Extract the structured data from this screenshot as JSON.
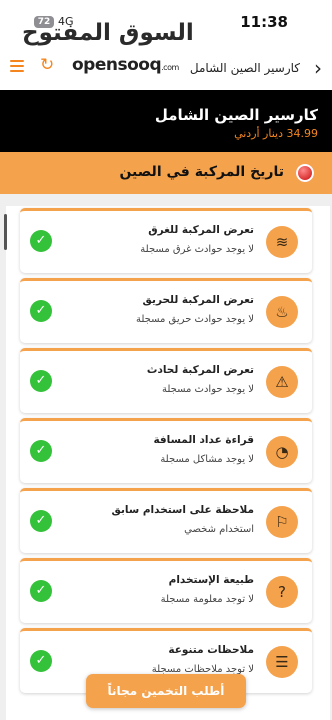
{
  "status_bar": {
    "battery": "72",
    "network": "4G",
    "time": "11:38"
  },
  "brand_arabic": "السوق المفتوح",
  "header": {
    "logo_text": "opensooq",
    "logo_suffix": ".com",
    "title": "كارسير الصين الشامل",
    "menu_icon": "hamburger-icon",
    "refresh_icon": "refresh-icon",
    "back_icon": "chevron-right-icon"
  },
  "car": {
    "name": "كارسير الصين الشامل",
    "price": "34.99 دينار أردني"
  },
  "section": {
    "title": "تاريخ المركبة في الصين"
  },
  "items": [
    {
      "title": "تعرض المركبة للغرق",
      "subtitle": "لا يوجد حوادث غرق مسجلة",
      "icon": "flood-car-icon",
      "glyph": "≋"
    },
    {
      "title": "تعرض المركبة للحريق",
      "subtitle": "لا يوجد حوادث حريق مسجلة",
      "icon": "fire-car-icon",
      "glyph": "♨"
    },
    {
      "title": "تعرض المركبة لحادث",
      "subtitle": "لا يوجد حوادث مسجلة",
      "icon": "crash-car-icon",
      "glyph": "⚠"
    },
    {
      "title": "قراءة عداد المسافة",
      "subtitle": "لا يوجد مشاكل مسجلة",
      "icon": "odometer-car-icon",
      "glyph": "◔"
    },
    {
      "title": "ملاحظة على استخدام سابق",
      "subtitle": "استخدام شخصي",
      "icon": "previous-use-car-icon",
      "glyph": "⚐"
    },
    {
      "title": "طبيعة الإستخدام",
      "subtitle": "لا توجد معلومة مسجلة",
      "icon": "usage-car-icon",
      "glyph": "?"
    },
    {
      "title": "ملاحظات متنوعة",
      "subtitle": "لا توجد ملاحظات مسجلة",
      "icon": "notes-list-icon",
      "glyph": "☰"
    }
  ],
  "cta": {
    "label": "أطلب التخمين مجاناً"
  },
  "colors": {
    "accent": "#f5a24d",
    "check": "#34c23a",
    "banner": "#000000"
  }
}
